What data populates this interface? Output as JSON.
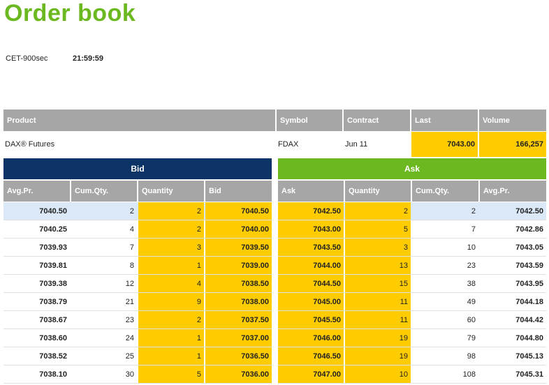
{
  "page": {
    "title": "Order book",
    "timezone": "CET-900sec",
    "time": "21:59:59"
  },
  "product_table": {
    "headers": [
      "Product",
      "Symbol",
      "Contract",
      "Last",
      "Volume"
    ],
    "row": {
      "product": "DAX® Futures",
      "symbol": "FDAX",
      "contract": "Jun 11",
      "last": "7043.00",
      "volume": "166,257"
    }
  },
  "bid": {
    "label": "Bid",
    "headers": [
      "Avg.Pr.",
      "Cum.Qty.",
      "Quantity",
      "Bid"
    ],
    "rows": [
      {
        "avg": "7040.50",
        "cum": "2",
        "qty": "2",
        "price": "7040.50"
      },
      {
        "avg": "7040.25",
        "cum": "4",
        "qty": "2",
        "price": "7040.00"
      },
      {
        "avg": "7039.93",
        "cum": "7",
        "qty": "3",
        "price": "7039.50"
      },
      {
        "avg": "7039.81",
        "cum": "8",
        "qty": "1",
        "price": "7039.00"
      },
      {
        "avg": "7039.38",
        "cum": "12",
        "qty": "4",
        "price": "7038.50"
      },
      {
        "avg": "7038.79",
        "cum": "21",
        "qty": "9",
        "price": "7038.00"
      },
      {
        "avg": "7038.67",
        "cum": "23",
        "qty": "2",
        "price": "7037.50"
      },
      {
        "avg": "7038.60",
        "cum": "24",
        "qty": "1",
        "price": "7037.00"
      },
      {
        "avg": "7038.52",
        "cum": "25",
        "qty": "1",
        "price": "7036.50"
      },
      {
        "avg": "7038.10",
        "cum": "30",
        "qty": "5",
        "price": "7036.00"
      }
    ]
  },
  "ask": {
    "label": "Ask",
    "headers": [
      "Ask",
      "Quantity",
      "Cum.Qty.",
      "Avg.Pr."
    ],
    "rows": [
      {
        "price": "7042.50",
        "qty": "2",
        "cum": "2",
        "avg": "7042.50"
      },
      {
        "price": "7043.00",
        "qty": "5",
        "cum": "7",
        "avg": "7042.86"
      },
      {
        "price": "7043.50",
        "qty": "3",
        "cum": "10",
        "avg": "7043.05"
      },
      {
        "price": "7044.00",
        "qty": "13",
        "cum": "23",
        "avg": "7043.59"
      },
      {
        "price": "7044.50",
        "qty": "15",
        "cum": "38",
        "avg": "7043.95"
      },
      {
        "price": "7045.00",
        "qty": "11",
        "cum": "49",
        "avg": "7044.18"
      },
      {
        "price": "7045.50",
        "qty": "11",
        "cum": "60",
        "avg": "7044.42"
      },
      {
        "price": "7046.00",
        "qty": "19",
        "cum": "79",
        "avg": "7044.80"
      },
      {
        "price": "7046.50",
        "qty": "19",
        "cum": "98",
        "avg": "7045.13"
      },
      {
        "price": "7047.00",
        "qty": "10",
        "cum": "108",
        "avg": "7045.31"
      }
    ]
  },
  "colors": {
    "brand_green": "#6cb820",
    "bid_blue": "#0b3366",
    "header_gray": "#a6a6a6",
    "qty_yellow": "#ffcc00",
    "highlight_blue": "#dbe8f7"
  }
}
